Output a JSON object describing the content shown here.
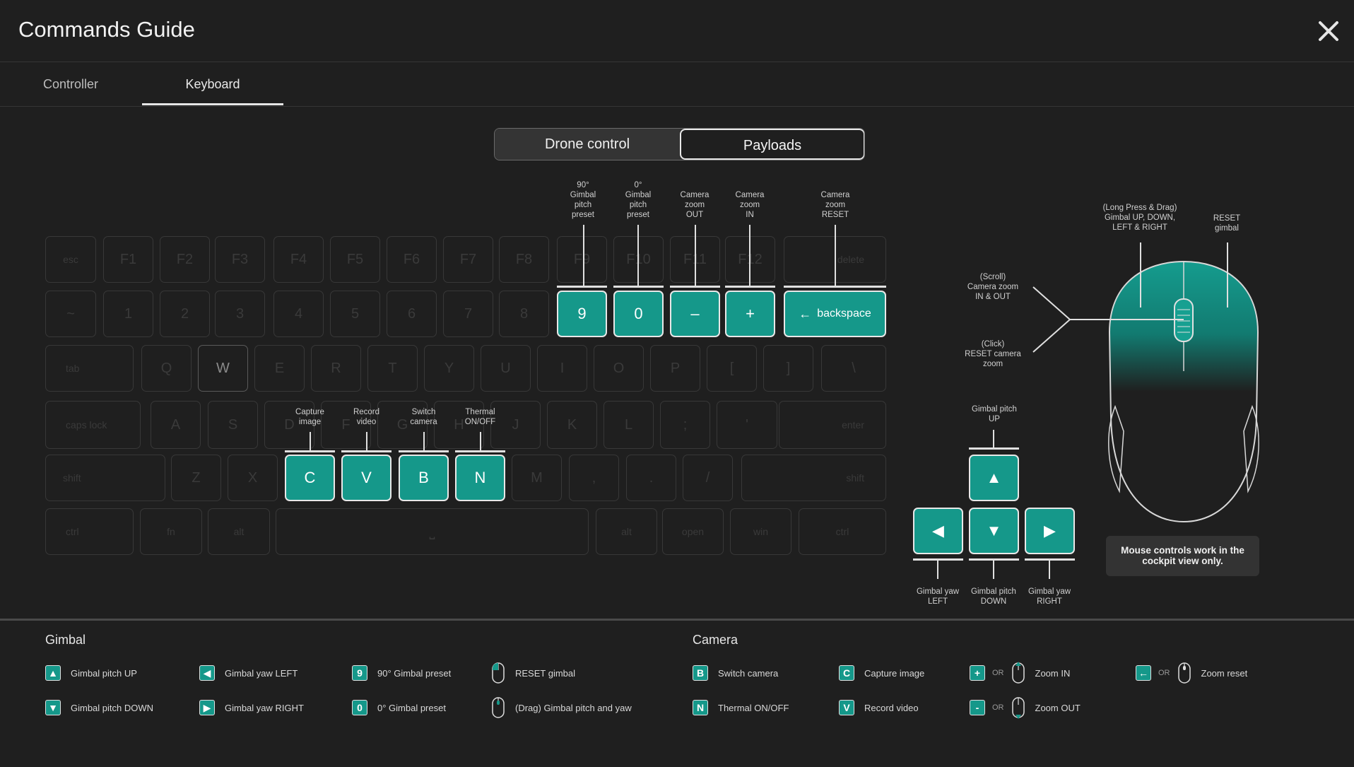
{
  "header": {
    "title": "Commands Guide"
  },
  "tabs": [
    {
      "label": "Controller"
    },
    {
      "label": "Keyboard"
    }
  ],
  "segment": {
    "left": "Drone control",
    "right": "Payloads"
  },
  "keys": {
    "esc": "esc",
    "f1": "F1",
    "f2": "F2",
    "f3": "F3",
    "f4": "F4",
    "f5": "F5",
    "f6": "F6",
    "f7": "F7",
    "f8": "F8",
    "f9": "F9",
    "f10": "F10",
    "f11": "F11",
    "f12": "F12",
    "delete": "delete",
    "tilde": "~",
    "n1": "1",
    "n2": "2",
    "n3": "3",
    "n4": "4",
    "n5": "5",
    "n6": "6",
    "n7": "7",
    "n8": "8",
    "n9": "9",
    "n0": "0",
    "minus": "–",
    "plus": "+",
    "backspace": "backspace",
    "tab": "tab",
    "q": "Q",
    "w": "W",
    "e": "E",
    "r": "R",
    "t": "T",
    "y": "Y",
    "u": "U",
    "i": "I",
    "o": "O",
    "p": "P",
    "lbr": "[",
    "rbr": "]",
    "bsl": "\\",
    "caps": "caps lock",
    "a": "A",
    "s": "S",
    "d": "D",
    "f": "F",
    "g": "G",
    "h": "H",
    "j": "J",
    "k": "K",
    "l": "L",
    "semi": ";",
    "quote": "'",
    "enter": "enter",
    "shift": "shift",
    "z": "Z",
    "x": "X",
    "c": "C",
    "v": "V",
    "b": "B",
    "n": "N",
    "m": "M",
    "comma": ",",
    "dot": ".",
    "slash": "/",
    "rshift": "shift",
    "ctrl": "ctrl",
    "fn": "fn",
    "alt": "alt",
    "space": "⎵",
    "ralt": "alt",
    "open": "open",
    "win": "win",
    "rctrl": "ctrl"
  },
  "key_labels": {
    "n9": "90°\nGimbal\npitch\npreset",
    "n0": "0°\nGimbal\npitch\npreset",
    "minus": "Camera\nzoom\nOUT",
    "plus": "Camera\nzoom\nIN",
    "backspace": "Camera\nzoom\nRESET",
    "c": "Capture\nimage",
    "v": "Record\nvideo",
    "b": "Switch\ncamera",
    "n": "Thermal\nON/OFF",
    "up": "Gimbal pitch\nUP",
    "left": "Gimbal yaw\nLEFT",
    "down": "Gimbal pitch\nDOWN",
    "right": "Gimbal yaw\nRIGHT"
  },
  "mouse": {
    "drag": "(Long Press & Drag)\nGimbal UP, DOWN,\nLEFT & RIGHT",
    "reset": "RESET\ngimbal",
    "scroll": "(Scroll)\nCamera zoom\nIN  & OUT",
    "click": "(Click)\nRESET camera\nzoom",
    "note": "Mouse controls work in the cockpit view only."
  },
  "legend": {
    "gimbal": {
      "title": "Gimbal",
      "items": [
        {
          "icon": "▲",
          "label": "Gimbal pitch UP"
        },
        {
          "icon": "◀",
          "label": "Gimbal yaw LEFT"
        },
        {
          "icon": "9",
          "label": "90° Gimbal preset"
        },
        {
          "icon": "mouse",
          "label": "RESET gimbal"
        },
        {
          "icon": "▼",
          "label": "Gimbal pitch DOWN"
        },
        {
          "icon": "▶",
          "label": "Gimbal yaw RIGHT"
        },
        {
          "icon": "0",
          "label": "0° Gimbal preset"
        },
        {
          "icon": "mouse",
          "label": "(Drag) Gimbal pitch and yaw"
        }
      ]
    },
    "camera": {
      "title": "Camera",
      "items": [
        {
          "icon": "B",
          "label": "Switch camera"
        },
        {
          "icon": "C",
          "label": "Capture image"
        },
        {
          "icon": "+",
          "or": "OR",
          "label": "Zoom IN"
        },
        {
          "icon": "←",
          "or": "OR",
          "label": "Zoom reset"
        },
        {
          "icon": "N",
          "label": "Thermal ON/OFF"
        },
        {
          "icon": "V",
          "label": "Record video"
        },
        {
          "icon": "-",
          "or": "OR",
          "label": "Zoom OUT"
        }
      ]
    }
  },
  "colors": {
    "accent": "#15988a",
    "background": "#1f1f1f"
  }
}
